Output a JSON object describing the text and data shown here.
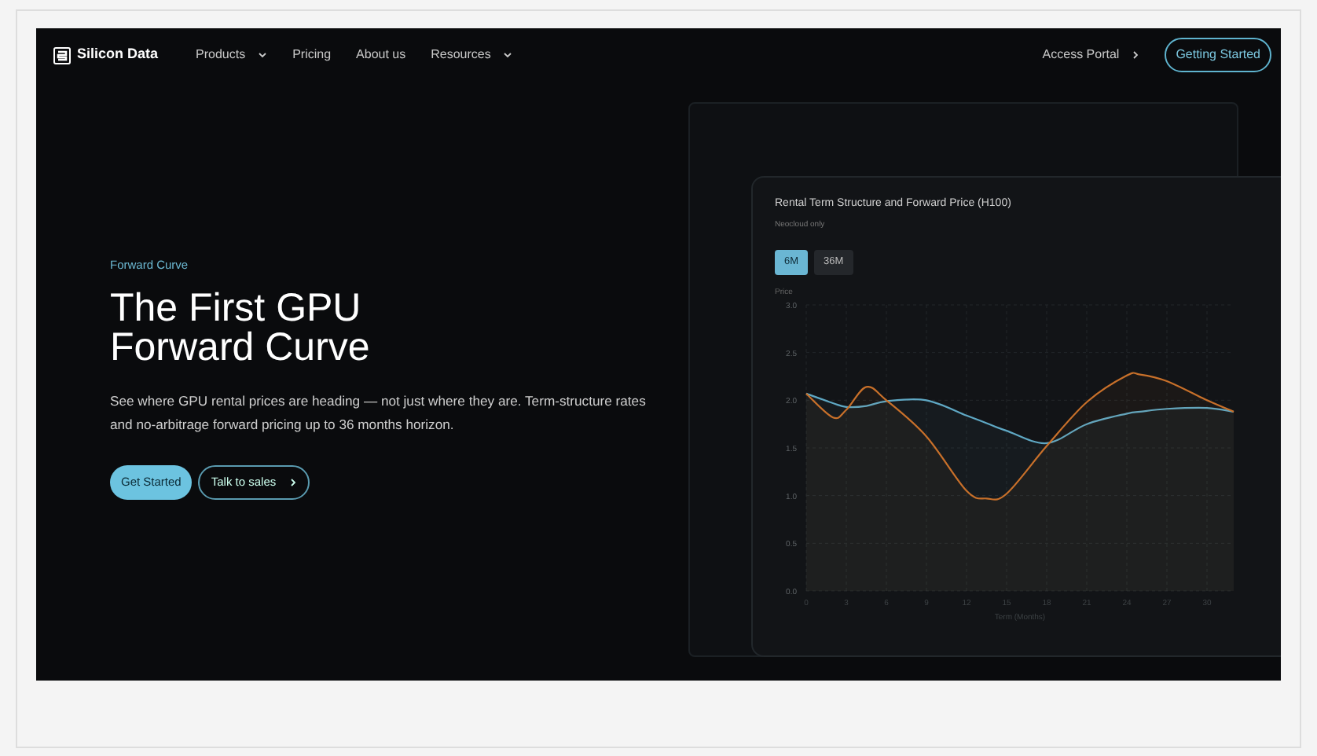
{
  "nav": {
    "brand": "Silicon Data",
    "items": [
      {
        "label": "Products",
        "dropdown": true
      },
      {
        "label": "Pricing",
        "dropdown": false
      },
      {
        "label": "About us",
        "dropdown": false
      },
      {
        "label": "Resources",
        "dropdown": true
      }
    ],
    "portal": "Access Portal",
    "cta": "Getting Started"
  },
  "hero": {
    "eyebrow": "Forward Curve",
    "title_lines": [
      "The First GPU",
      "Forward Curve"
    ],
    "text": "See where GPU rental prices are heading — not just where they are. Term-structure rates and no-arbitrage forward pricing up to 36 months horizon.",
    "primary": "Get Started",
    "secondary": "Talk to sales"
  },
  "chart_card": {
    "title": "Rental Term Structure and Forward Price (H100)",
    "subtitle": "Neocloud only",
    "tabs": [
      {
        "label": "6M",
        "selected": true
      },
      {
        "label": "36M",
        "selected": false
      }
    ],
    "chart_data": {
      "type": "area",
      "grid": true,
      "ylabel": "Price",
      "xlabel": "Term (Months)",
      "x": [
        0,
        2,
        3,
        4.5,
        6,
        9,
        12,
        13.5,
        15,
        18,
        21,
        24,
        25,
        27,
        30,
        32
      ],
      "series": [
        {
          "color": "#5fa8c4",
          "values": [
            2.07,
            1.97,
            1.93,
            1.94,
            1.99,
            2.0,
            1.84,
            1.76,
            1.68,
            1.55,
            1.75,
            1.86,
            1.88,
            1.91,
            1.92,
            1.88
          ]
        },
        {
          "color": "#c8702a",
          "values": [
            2.07,
            1.82,
            1.9,
            2.14,
            2.0,
            1.62,
            1.05,
            0.97,
            1.02,
            1.52,
            1.98,
            2.26,
            2.27,
            2.2,
            2.0,
            1.88
          ]
        }
      ],
      "xlim": [
        0,
        32
      ],
      "ylim": [
        0,
        3
      ],
      "xticks": [
        0,
        3,
        6,
        9,
        12,
        15,
        18,
        21,
        24,
        27,
        30
      ],
      "yticks": [
        {
          "value": 0,
          "label": "0.0"
        },
        {
          "value": 0.5,
          "label": "0.5"
        },
        {
          "value": 1,
          "label": "1.0"
        },
        {
          "value": 1.5,
          "label": "1.5"
        },
        {
          "value": 2,
          "label": "2.0"
        },
        {
          "value": 2.5,
          "label": "2.5"
        },
        {
          "value": 3,
          "label": "3.0"
        }
      ]
    }
  }
}
